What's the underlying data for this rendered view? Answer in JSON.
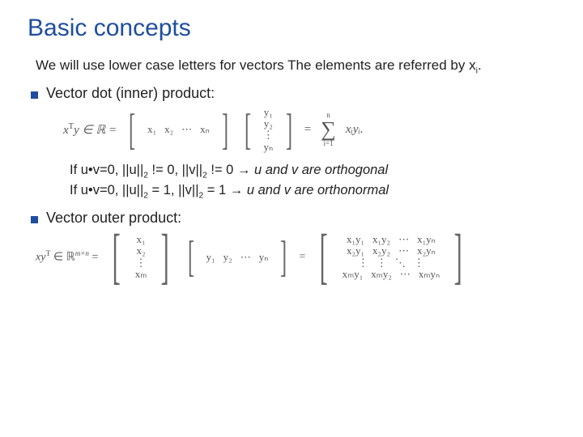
{
  "title": "Basic concepts",
  "intro_a": "We will use lower case letters for vectors The elements are referred by x",
  "intro_sub": "i",
  "intro_b": ".",
  "bullet1": "Vector dot (inner) product:",
  "bullet2": "Vector outer product:",
  "inner": {
    "lhs": "x",
    "lhs_sup": "T",
    "lhs2": "y ∈ ℝ =",
    "row": [
      "x₁",
      "x₂",
      "⋯",
      "xₙ"
    ],
    "col": [
      "y₁",
      "y₂",
      "⋮",
      "yₙ"
    ],
    "eq": "=",
    "sum_top": "n",
    "sum_bot": "i=1",
    "sum_body": "xᵢyᵢ."
  },
  "cond1_a": "If u•v=0, ||u||",
  "cond1_b": " != 0, ||v||",
  "cond1_c": " != 0 ",
  "cond1_arrow": "→",
  "cond1_d": " u and v are ",
  "cond1_e": "orthogonal",
  "cond2_a": "If u•v=0, ||u||",
  "cond2_b": " = 1, ||v||",
  "cond2_c": " = 1 ",
  "cond2_arrow": "→",
  "cond2_d": " u and v are ",
  "cond2_e": "orthonormal",
  "norm_sub": "2",
  "outer": {
    "lhs": "xy",
    "lhs_sup": "T",
    "lhs2": " ∈ ℝ",
    "lhs_dim": "m×n",
    "eq1": " =",
    "colx": [
      "x₁",
      "x₂",
      "⋮",
      "xₘ"
    ],
    "rowy": [
      "y₁",
      "y₂",
      "⋯",
      "yₙ"
    ],
    "eq2": "=",
    "mat": [
      [
        "x₁y₁",
        "x₁y₂",
        "⋯",
        "x₁yₙ"
      ],
      [
        "x₂y₁",
        "x₂y₂",
        "⋯",
        "x₂yₙ"
      ],
      [
        "⋮",
        "⋮",
        "⋱",
        "⋮"
      ],
      [
        "xₘy₁",
        "xₘy₂",
        "⋯",
        "xₘyₙ"
      ]
    ]
  }
}
